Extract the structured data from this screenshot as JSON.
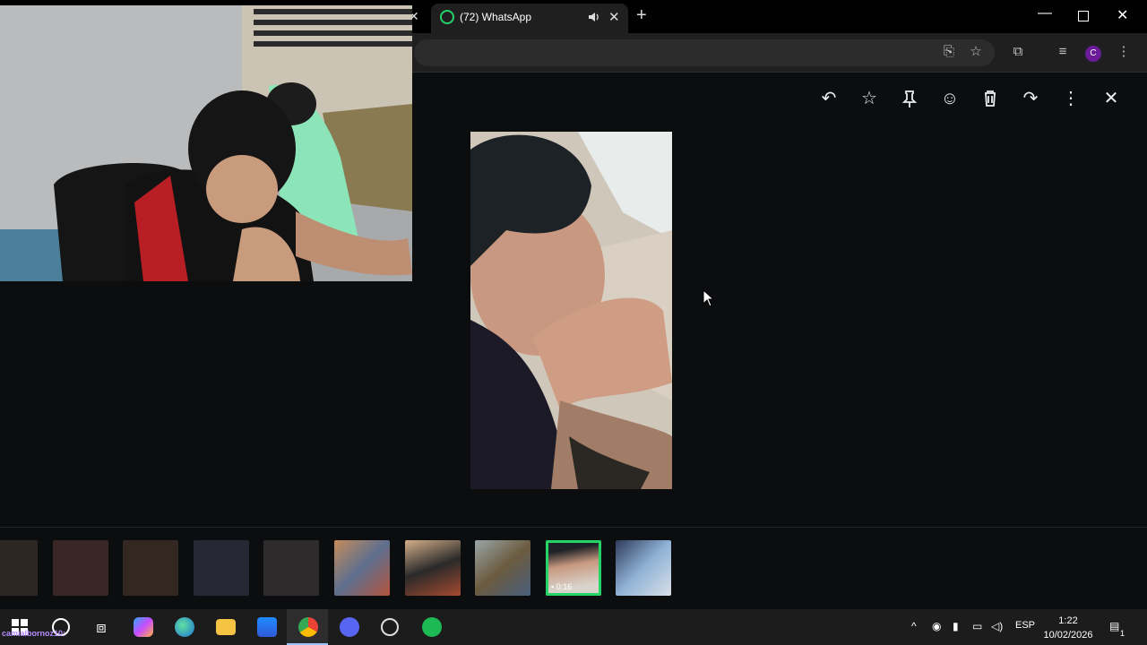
{
  "browser": {
    "tab_title": "(72) WhatsApp",
    "profile_initial": "C"
  },
  "media_viewer": {
    "actions": [
      "reply",
      "star",
      "pin",
      "react",
      "delete",
      "forward",
      "more",
      "close"
    ]
  },
  "thumbnails": [
    {
      "kind": "photo",
      "active": false
    },
    {
      "kind": "photo",
      "active": false
    },
    {
      "kind": "photo",
      "active": false
    },
    {
      "kind": "photo",
      "active": false
    },
    {
      "kind": "photo",
      "active": false
    },
    {
      "kind": "photo",
      "active": false
    },
    {
      "kind": "photo",
      "active": false
    },
    {
      "kind": "photo",
      "active": false
    },
    {
      "kind": "video",
      "duration": "0:16",
      "active": true
    },
    {
      "kind": "photo",
      "active": false
    }
  ],
  "taskbar": {
    "overlay_username": "camialbornoz10:",
    "language": "ESP",
    "time": "1:22",
    "date": "10/02/2026",
    "notification_count": "1"
  },
  "colors": {
    "whatsapp_green": "#25d366",
    "viewer_bg": "#0b0d0f",
    "chrome_toolbar": "#1f1f1f"
  }
}
